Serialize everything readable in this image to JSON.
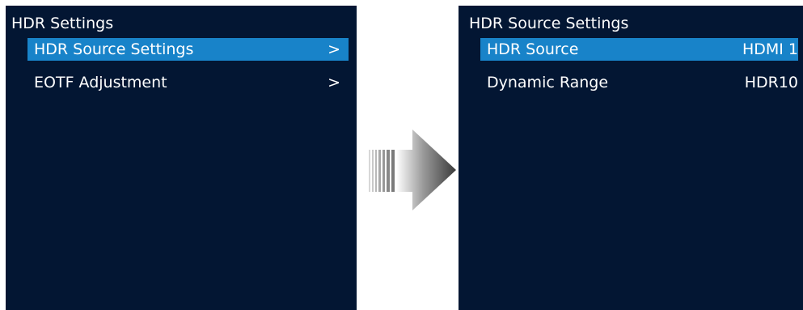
{
  "left_panel": {
    "title": "HDR Settings",
    "items": [
      {
        "label": "HDR Source Settings",
        "chevron": ">"
      },
      {
        "label": "EOTF Adjustment",
        "chevron": ">"
      }
    ]
  },
  "right_panel": {
    "title": "HDR Source Settings",
    "items": [
      {
        "label": "HDR Source",
        "value": "HDMI 1"
      },
      {
        "label": "Dynamic Range",
        "value": "HDR10"
      }
    ]
  },
  "colors": {
    "panel_background": "#031633",
    "selection_highlight": "#1883c9",
    "text": "#ffffff"
  },
  "icons": {
    "transition": "right-arrow-icon"
  }
}
